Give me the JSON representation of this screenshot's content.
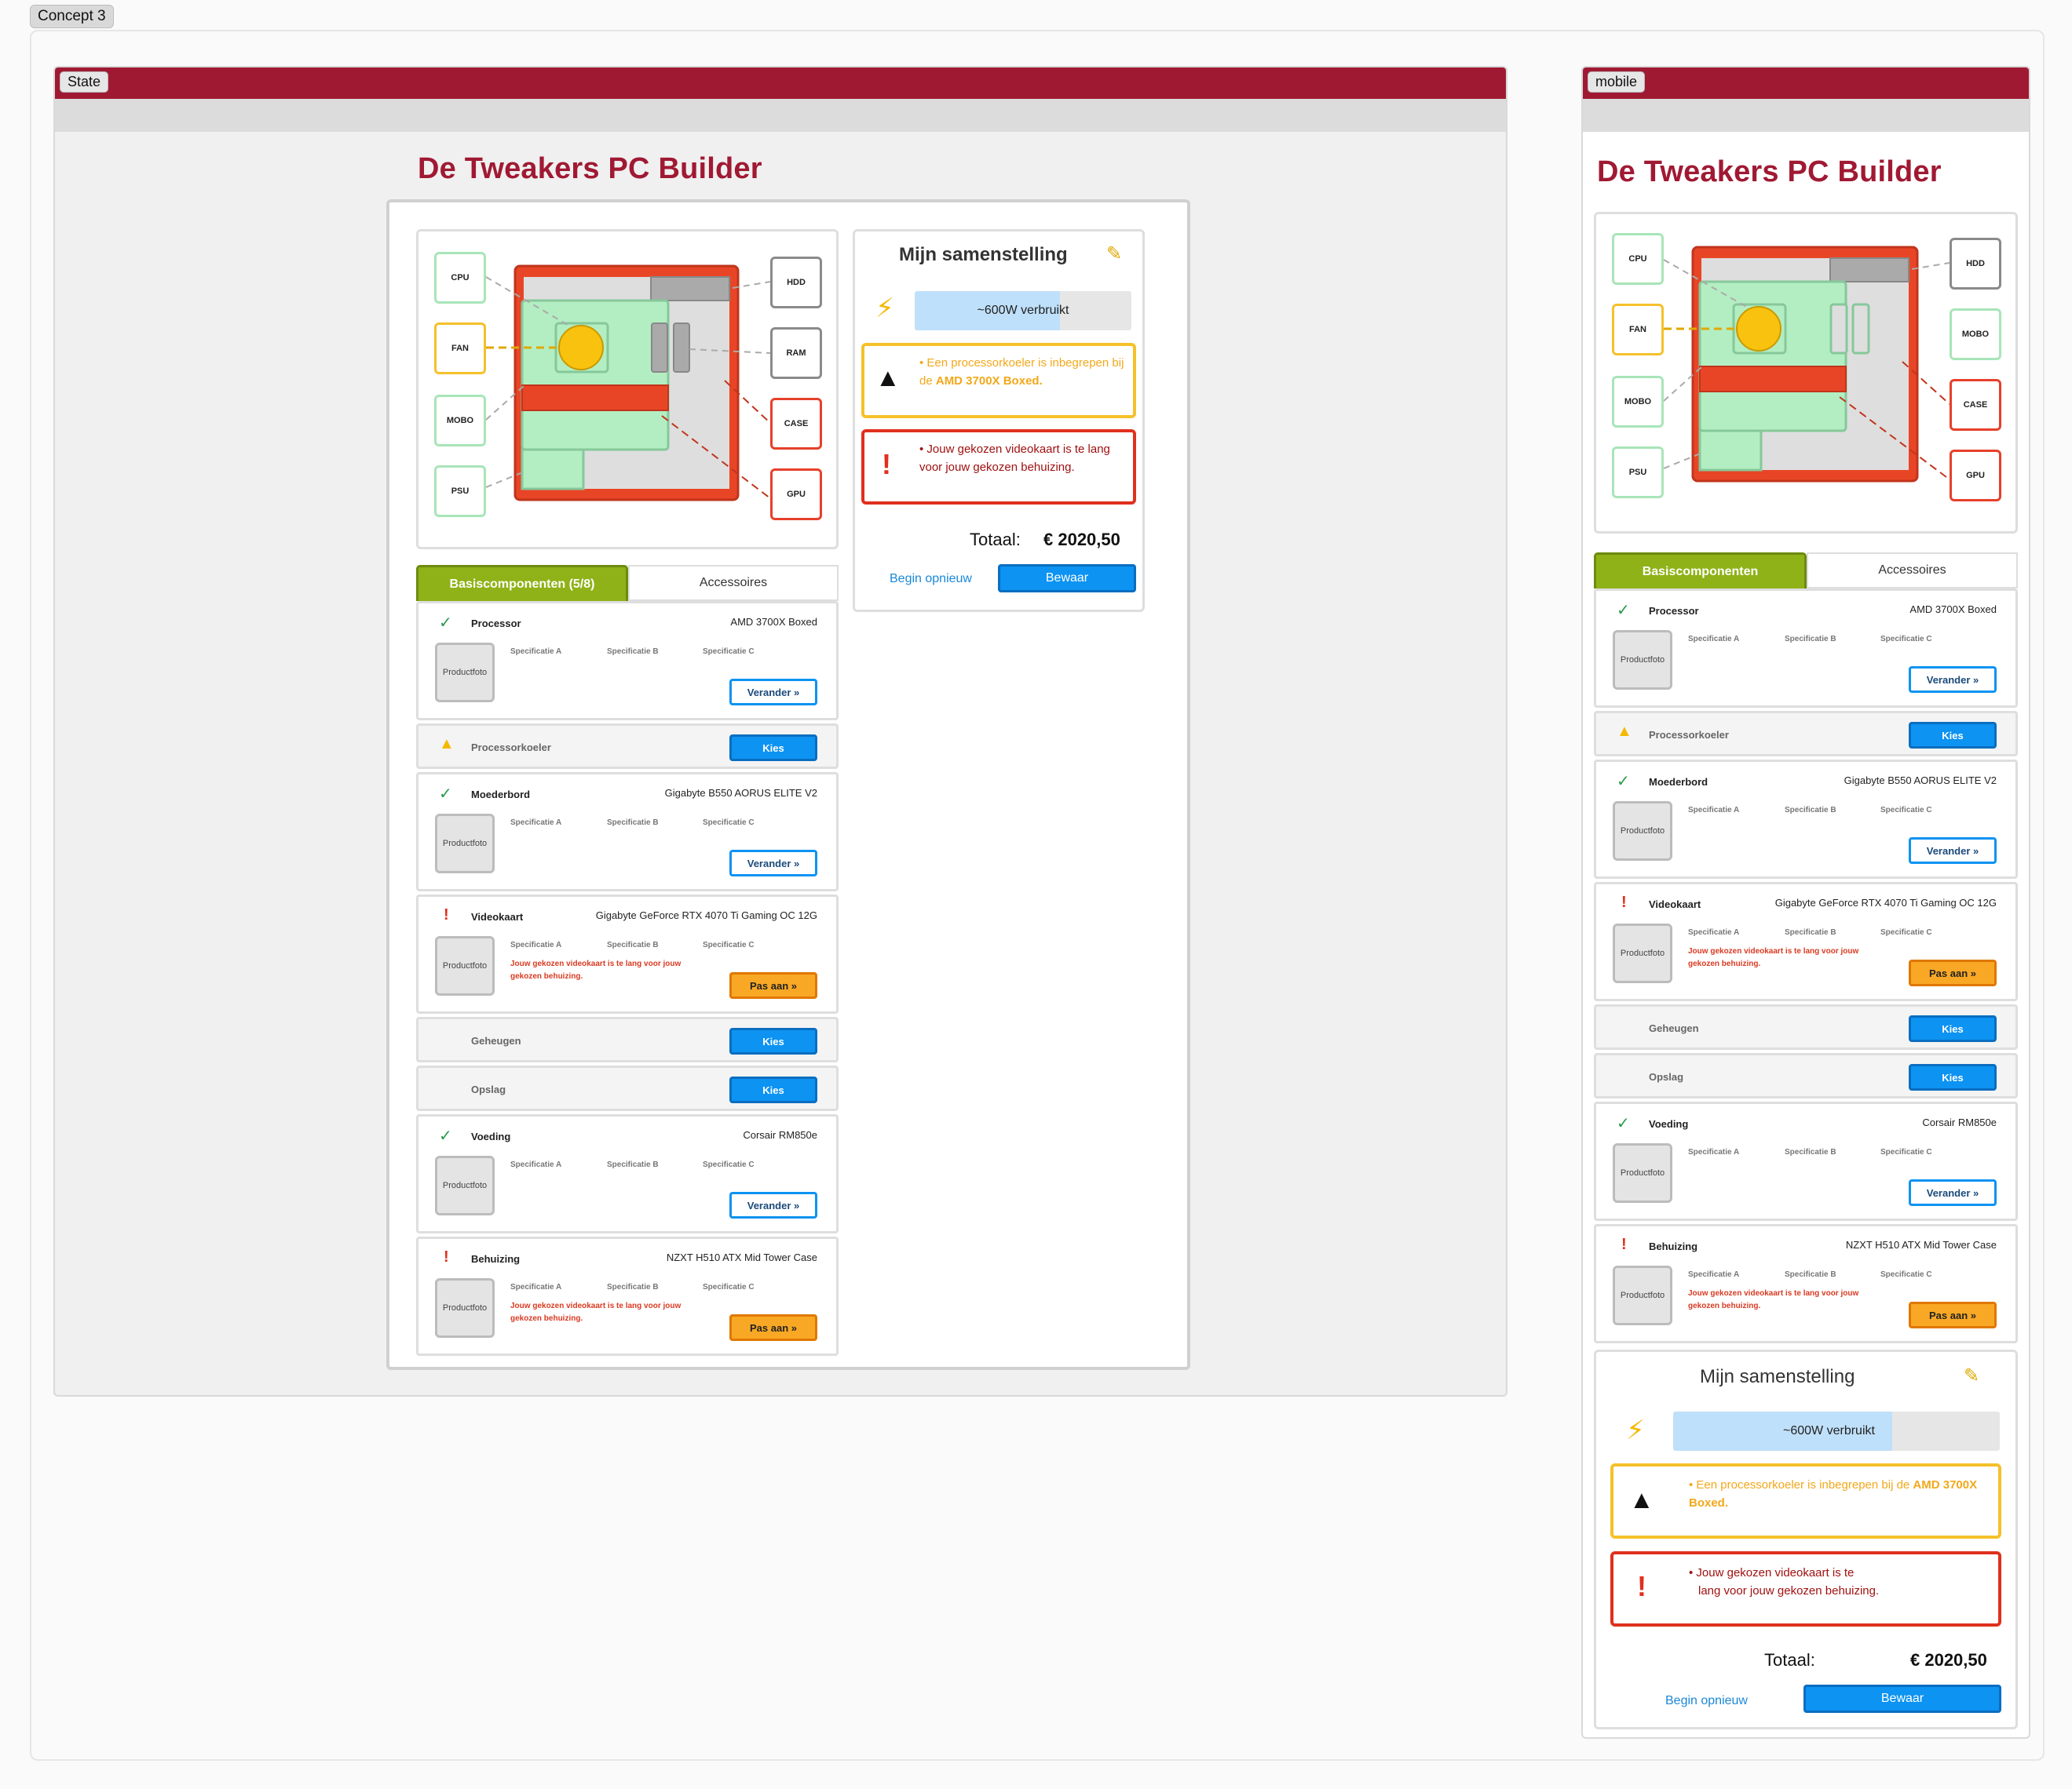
{
  "concept_label": "Concept 3",
  "desktop": {
    "frame_label": "State",
    "title": "De Tweakers PC Builder",
    "diagram_nodes": {
      "cpu": "CPU",
      "fan": "FAN",
      "mobo": "MOBO",
      "psu": "PSU",
      "hdd": "HDD",
      "ram": "RAM",
      "case": "CASE",
      "gpu": "GPU"
    },
    "tabs": {
      "base": "Basiscomponenten (5/8)",
      "accessories": "Accessoires"
    },
    "summary": {
      "title": "Mijn samenstelling",
      "power": "~600W verbruikt",
      "power_fraction": 0.67,
      "warn_text_1": "Een processorkoeler is inbegrepen bij de ",
      "warn_bold": "AMD 3700X Boxed.",
      "error_text": "Jouw gekozen videokaart is te lang voor jouw gekozen behuizing.",
      "total_label": "Totaal:",
      "total_value": "€ 2020,50",
      "reset": "Begin opnieuw",
      "save": "Bewaar"
    }
  },
  "mobile": {
    "frame_label": "mobile",
    "title": "De Tweakers PC Builder",
    "tabs": {
      "base": "Basiscomponenten",
      "accessories": "Accessoires"
    },
    "summary": {
      "title": "Mijn samenstelling",
      "power": "~600W verbruikt",
      "power_fraction": 0.67,
      "warn_text_1": "Een processorkoeler is inbegrepen bij de ",
      "warn_bold": "AMD 3700X Boxed.",
      "error_text_1": "Jouw gekozen videokaart is te",
      "error_text_2": "lang voor jouw gekozen behuizing.",
      "total_label": "Totaal:",
      "total_value": "€ 2020,50",
      "reset": "Begin opnieuw",
      "save": "Bewaar"
    }
  },
  "labels": {
    "photo": "Productfoto",
    "spec_a": "Specificatie A",
    "spec_b": "Specificatie B",
    "spec_c": "Specificatie C",
    "change": "Verander »",
    "choose": "Kies",
    "adjust": "Pas aan »",
    "gpu_error": "Jouw gekozen videokaart is te lang voor jouw gekozen behuizing."
  },
  "components": {
    "processor": {
      "name": "Processor",
      "product": "AMD 3700X Boxed"
    },
    "cooler": {
      "name": "Processorkoeler"
    },
    "mobo": {
      "name": "Moederbord",
      "product": "Gigabyte B550 AORUS ELITE V2"
    },
    "gpu": {
      "name": "Videokaart",
      "product": "Gigabyte GeForce RTX 4070 Ti Gaming OC 12G"
    },
    "memory": {
      "name": "Geheugen"
    },
    "storage": {
      "name": "Opslag"
    },
    "psu": {
      "name": "Voeding",
      "product": "Corsair RM850e"
    },
    "case": {
      "name": "Behuizing",
      "product": "NZXT H510 ATX Mid Tower Case"
    }
  },
  "icons": {
    "check": "check-icon",
    "warning": "warning-icon",
    "error": "exclamation-icon",
    "bolt": "lightning-icon",
    "pencil": "pencil-icon"
  }
}
